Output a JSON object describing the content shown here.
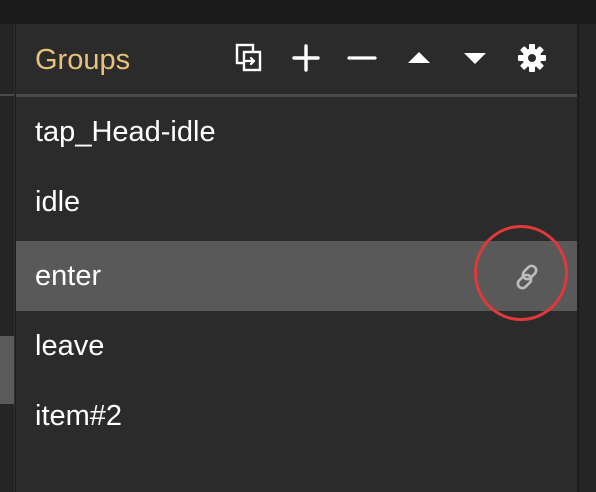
{
  "groups_panel": {
    "title": "Groups",
    "toolbar": {
      "duplicate_icon": "duplicate-icon",
      "add_icon": "plus-icon",
      "remove_icon": "minus-icon",
      "move_up_icon": "triangle-up-icon",
      "move_down_icon": "triangle-down-icon",
      "settings_icon": "gear-icon"
    },
    "items": [
      {
        "label": "tap_Head-idle",
        "selected": false
      },
      {
        "label": "idle",
        "selected": false
      },
      {
        "label": "enter",
        "selected": true,
        "trailing_icon": "link-icon"
      },
      {
        "label": "leave",
        "selected": false
      },
      {
        "label": "item#2",
        "selected": false
      }
    ]
  },
  "colors": {
    "title": "#e6c27a",
    "selected_row": "#595959",
    "panel_bg": "#2b2b2b",
    "annotation_ring": "#e0393a"
  }
}
